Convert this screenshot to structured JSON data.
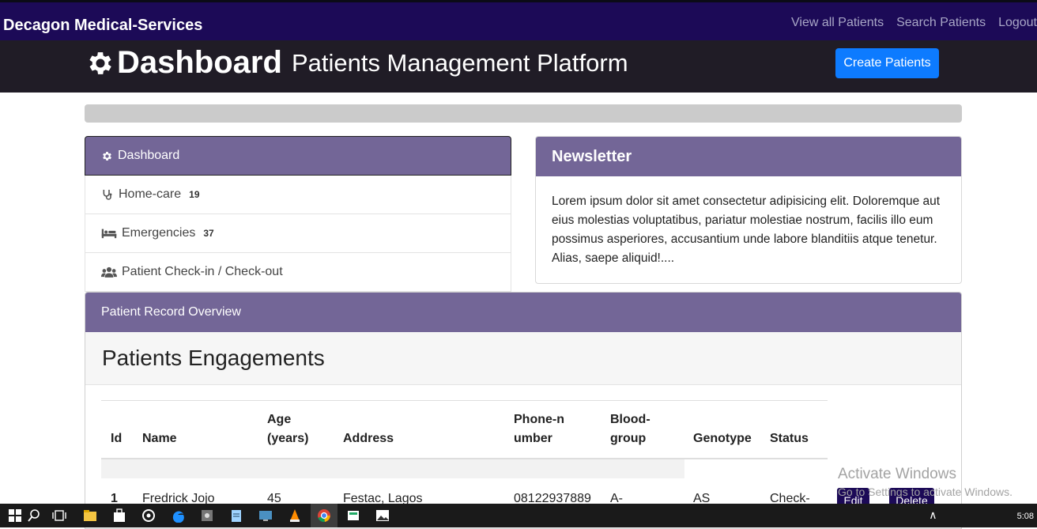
{
  "navbar": {
    "brand": "Decagon Medical-Services",
    "links": [
      "View all Patients",
      "Search Patients",
      "Logout"
    ]
  },
  "header": {
    "title": "Dashboard",
    "subtitle": "Patients Management Platform",
    "create_button": "Create Patients"
  },
  "sidebar": {
    "items": [
      {
        "label": "Dashboard",
        "icon": "gear-icon"
      },
      {
        "label": "Home-care",
        "badge": "19",
        "icon": "stethoscope-icon"
      },
      {
        "label": "Emergencies",
        "badge": "37",
        "icon": "bed-icon"
      },
      {
        "label": "Patient Check-in / Check-out",
        "icon": "users-icon"
      }
    ]
  },
  "newsletter": {
    "title": "Newsletter",
    "body": "Lorem ipsum dolor sit amet consectetur adipisicing elit. Doloremque aut eius molestias voluptatibus, pariatur molestiae nostrum, facilis illo eum possimus asperiores, accusantium unde labore blanditiis atque tenetur. Alias, saepe aliquid!...."
  },
  "overview": {
    "header": "Patient Record Overview",
    "title": "Patients Engagements",
    "columns": [
      "Id",
      "Name",
      "Age (years)",
      "Address",
      "Phone-number",
      "Blood-group",
      "Genotype",
      "Status"
    ],
    "rows": [
      {
        "id": "1",
        "name": "Fredrick Jojo",
        "age": "45",
        "address": "Festac, Lagos",
        "phone": "08122937889",
        "blood": "A-",
        "genotype": "AS",
        "status": "Check-Out"
      }
    ],
    "edit_label": "Edit",
    "delete_label": "Delete"
  },
  "watermark": {
    "title": "Activate Windows",
    "subtitle": "Go to Settings to activate Windows."
  },
  "taskbar": {
    "time": "5:08"
  },
  "colors": {
    "navbar": "#1c0a57",
    "header": "#201c26",
    "panel_header": "#736697",
    "primary_button": "#0d7bff"
  }
}
